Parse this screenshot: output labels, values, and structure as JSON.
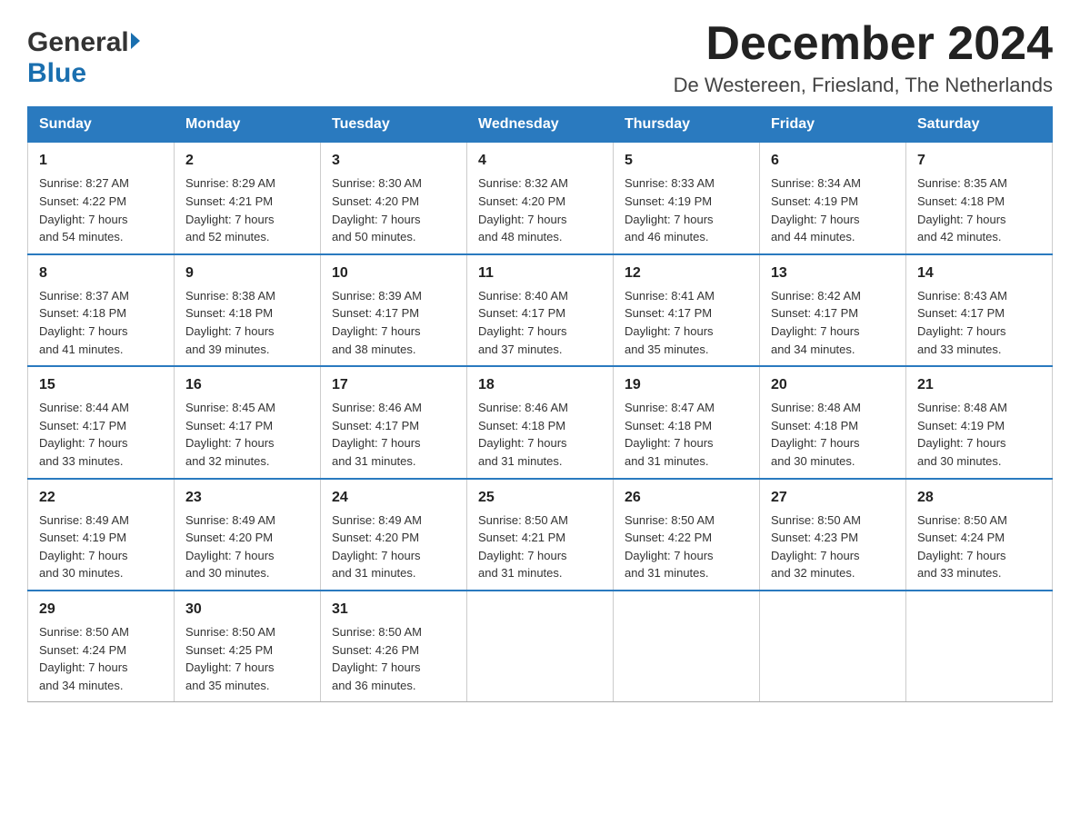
{
  "header": {
    "month_title": "December 2024",
    "location": "De Westereen, Friesland, The Netherlands",
    "logo_general": "General",
    "logo_blue": "Blue"
  },
  "weekdays": [
    "Sunday",
    "Monday",
    "Tuesday",
    "Wednesday",
    "Thursday",
    "Friday",
    "Saturday"
  ],
  "weeks": [
    [
      {
        "day": "1",
        "sunrise": "8:27 AM",
        "sunset": "4:22 PM",
        "daylight": "7 hours and 54 minutes."
      },
      {
        "day": "2",
        "sunrise": "8:29 AM",
        "sunset": "4:21 PM",
        "daylight": "7 hours and 52 minutes."
      },
      {
        "day": "3",
        "sunrise": "8:30 AM",
        "sunset": "4:20 PM",
        "daylight": "7 hours and 50 minutes."
      },
      {
        "day": "4",
        "sunrise": "8:32 AM",
        "sunset": "4:20 PM",
        "daylight": "7 hours and 48 minutes."
      },
      {
        "day": "5",
        "sunrise": "8:33 AM",
        "sunset": "4:19 PM",
        "daylight": "7 hours and 46 minutes."
      },
      {
        "day": "6",
        "sunrise": "8:34 AM",
        "sunset": "4:19 PM",
        "daylight": "7 hours and 44 minutes."
      },
      {
        "day": "7",
        "sunrise": "8:35 AM",
        "sunset": "4:18 PM",
        "daylight": "7 hours and 42 minutes."
      }
    ],
    [
      {
        "day": "8",
        "sunrise": "8:37 AM",
        "sunset": "4:18 PM",
        "daylight": "7 hours and 41 minutes."
      },
      {
        "day": "9",
        "sunrise": "8:38 AM",
        "sunset": "4:18 PM",
        "daylight": "7 hours and 39 minutes."
      },
      {
        "day": "10",
        "sunrise": "8:39 AM",
        "sunset": "4:17 PM",
        "daylight": "7 hours and 38 minutes."
      },
      {
        "day": "11",
        "sunrise": "8:40 AM",
        "sunset": "4:17 PM",
        "daylight": "7 hours and 37 minutes."
      },
      {
        "day": "12",
        "sunrise": "8:41 AM",
        "sunset": "4:17 PM",
        "daylight": "7 hours and 35 minutes."
      },
      {
        "day": "13",
        "sunrise": "8:42 AM",
        "sunset": "4:17 PM",
        "daylight": "7 hours and 34 minutes."
      },
      {
        "day": "14",
        "sunrise": "8:43 AM",
        "sunset": "4:17 PM",
        "daylight": "7 hours and 33 minutes."
      }
    ],
    [
      {
        "day": "15",
        "sunrise": "8:44 AM",
        "sunset": "4:17 PM",
        "daylight": "7 hours and 33 minutes."
      },
      {
        "day": "16",
        "sunrise": "8:45 AM",
        "sunset": "4:17 PM",
        "daylight": "7 hours and 32 minutes."
      },
      {
        "day": "17",
        "sunrise": "8:46 AM",
        "sunset": "4:17 PM",
        "daylight": "7 hours and 31 minutes."
      },
      {
        "day": "18",
        "sunrise": "8:46 AM",
        "sunset": "4:18 PM",
        "daylight": "7 hours and 31 minutes."
      },
      {
        "day": "19",
        "sunrise": "8:47 AM",
        "sunset": "4:18 PM",
        "daylight": "7 hours and 31 minutes."
      },
      {
        "day": "20",
        "sunrise": "8:48 AM",
        "sunset": "4:18 PM",
        "daylight": "7 hours and 30 minutes."
      },
      {
        "day": "21",
        "sunrise": "8:48 AM",
        "sunset": "4:19 PM",
        "daylight": "7 hours and 30 minutes."
      }
    ],
    [
      {
        "day": "22",
        "sunrise": "8:49 AM",
        "sunset": "4:19 PM",
        "daylight": "7 hours and 30 minutes."
      },
      {
        "day": "23",
        "sunrise": "8:49 AM",
        "sunset": "4:20 PM",
        "daylight": "7 hours and 30 minutes."
      },
      {
        "day": "24",
        "sunrise": "8:49 AM",
        "sunset": "4:20 PM",
        "daylight": "7 hours and 31 minutes."
      },
      {
        "day": "25",
        "sunrise": "8:50 AM",
        "sunset": "4:21 PM",
        "daylight": "7 hours and 31 minutes."
      },
      {
        "day": "26",
        "sunrise": "8:50 AM",
        "sunset": "4:22 PM",
        "daylight": "7 hours and 31 minutes."
      },
      {
        "day": "27",
        "sunrise": "8:50 AM",
        "sunset": "4:23 PM",
        "daylight": "7 hours and 32 minutes."
      },
      {
        "day": "28",
        "sunrise": "8:50 AM",
        "sunset": "4:24 PM",
        "daylight": "7 hours and 33 minutes."
      }
    ],
    [
      {
        "day": "29",
        "sunrise": "8:50 AM",
        "sunset": "4:24 PM",
        "daylight": "7 hours and 34 minutes."
      },
      {
        "day": "30",
        "sunrise": "8:50 AM",
        "sunset": "4:25 PM",
        "daylight": "7 hours and 35 minutes."
      },
      {
        "day": "31",
        "sunrise": "8:50 AM",
        "sunset": "4:26 PM",
        "daylight": "7 hours and 36 minutes."
      },
      null,
      null,
      null,
      null
    ]
  ],
  "labels": {
    "sunrise": "Sunrise:",
    "sunset": "Sunset:",
    "daylight": "Daylight:"
  }
}
